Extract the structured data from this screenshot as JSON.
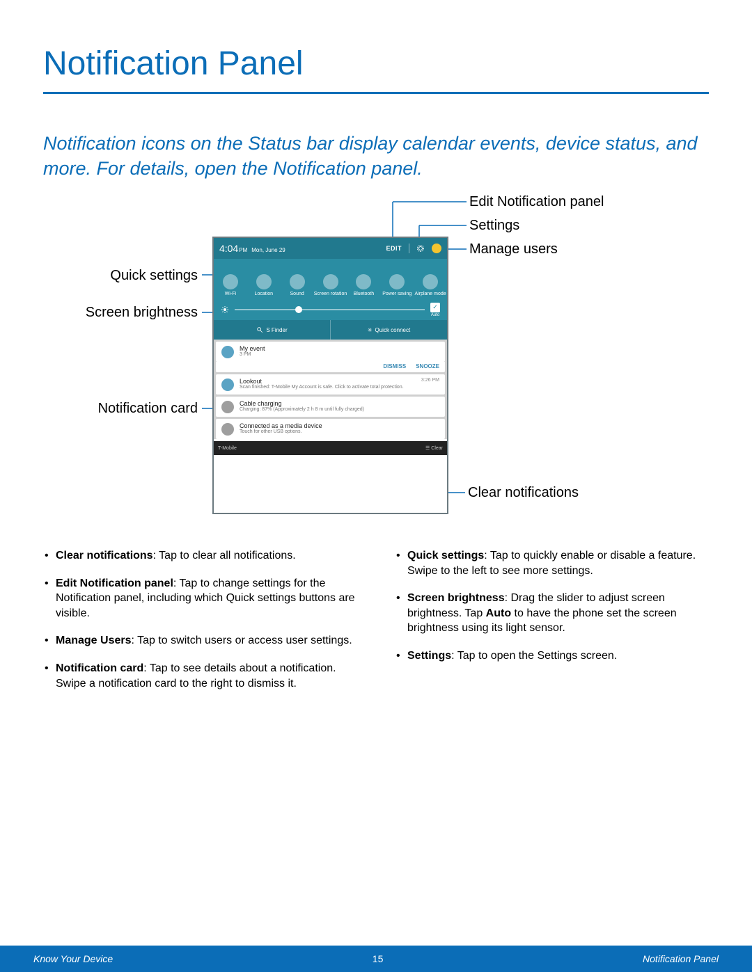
{
  "page": {
    "title": "Notification Panel",
    "intro": "Notification icons on the Status bar display calendar events, device status, and more. For details, open the Notification panel."
  },
  "callouts": {
    "edit_panel": "Edit Notification panel",
    "settings": "Settings",
    "manage_users": "Manage users",
    "quick_settings": "Quick settings",
    "screen_brightness": "Screen brightness",
    "notification_card": "Notification card",
    "clear_notifications": "Clear notifications"
  },
  "screenshot": {
    "statusbar": {
      "time": "4:04",
      "ampm": "PM",
      "date": "Mon, June 29",
      "edit": "EDIT"
    },
    "quick_settings": [
      {
        "label": "Wi-Fi"
      },
      {
        "label": "Location"
      },
      {
        "label": "Sound"
      },
      {
        "label": "Screen rotation"
      },
      {
        "label": "Bluetooth"
      },
      {
        "label": "Power saving"
      },
      {
        "label": "Airplane mode"
      }
    ],
    "brightness_auto": "Auto",
    "finder": {
      "sfinder": "S Finder",
      "quick_connect": "Quick connect"
    },
    "cards": [
      {
        "title": "My event",
        "sub": "3 PM",
        "rt": "",
        "actions": [
          "DISMISS",
          "SNOOZE"
        ],
        "badge": "teal"
      },
      {
        "title": "Lookout",
        "sub": "Scan finished: T-Mobile My Account is safe. Click to activate total protection.",
        "rt": "3:26 PM",
        "badge": "teal"
      },
      {
        "title": "Cable charging",
        "sub": "Charging: 87% (Approximately 2 h 8 m until fully charged)",
        "rt": "",
        "badge": "gray"
      },
      {
        "title": "Connected as a media device",
        "sub": "Touch for other USB options.",
        "rt": "",
        "badge": "gray"
      }
    ],
    "footerbar": {
      "carrier": "T-Mobile",
      "clear": "Clear"
    }
  },
  "bullets": {
    "left": [
      {
        "b": "Clear notifications",
        "t": ": Tap to clear all notifications."
      },
      {
        "b": "Edit Notification panel",
        "t": ": Tap to change settings for the Notification panel, including which Quick settings buttons are visible."
      },
      {
        "b": "Manage Users",
        "t": ": Tap to switch users or access user settings."
      },
      {
        "b": "Notification card",
        "t": ": Tap to see details about a notification. Swipe a notification card to the right to dismiss it."
      }
    ],
    "right": [
      {
        "b": "Quick settings",
        "t": ": Tap to quickly enable or disable a feature. Swipe to the left to see more settings."
      },
      {
        "b": "Screen brightness",
        "t": ": Drag the slider to adjust screen brightness. Tap ",
        "b2": "Auto",
        "t2": " to have the phone set the screen brightness using its light sensor."
      },
      {
        "b": "Settings",
        "t": ": Tap to open the Settings screen."
      }
    ]
  },
  "footer": {
    "left": "Know Your Device",
    "page": "15",
    "right": "Notification Panel"
  }
}
